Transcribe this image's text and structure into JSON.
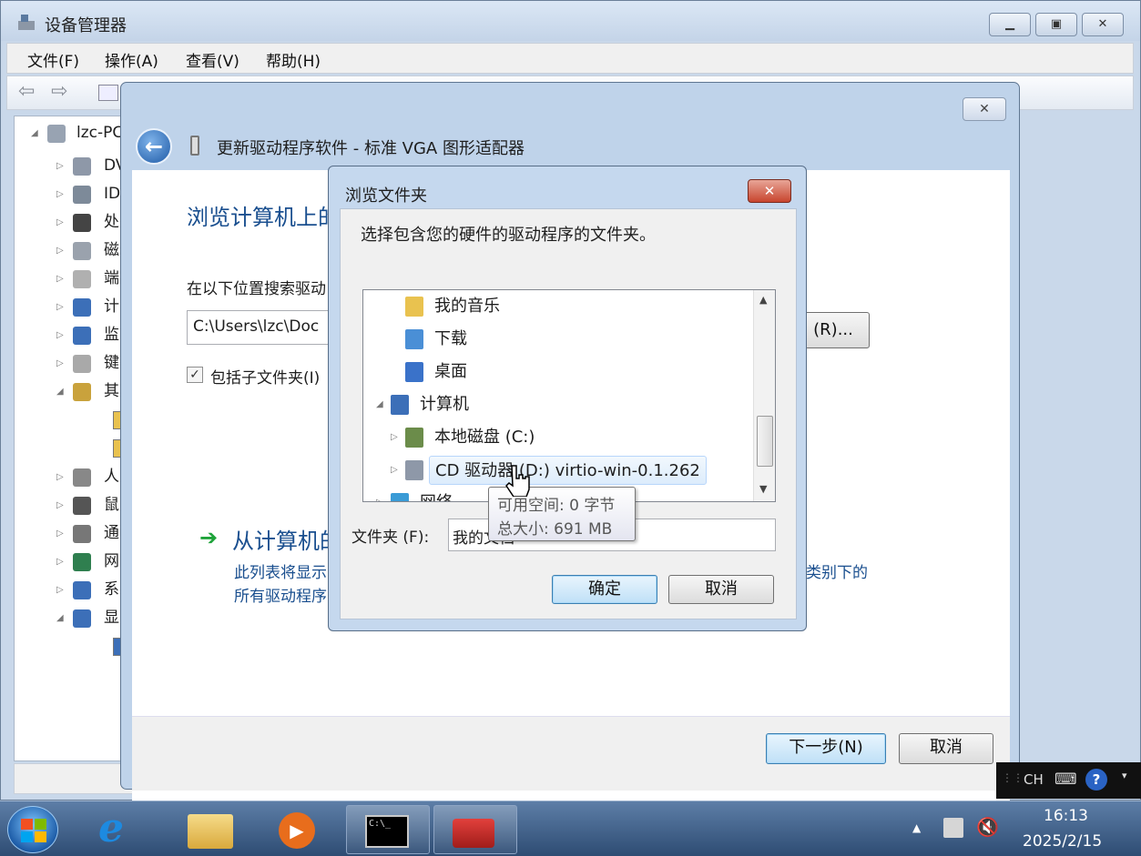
{
  "device_manager": {
    "title": "设备管理器",
    "menu": [
      "文件(F)",
      "操作(A)",
      "查看(V)",
      "帮助(H)"
    ],
    "caption_buttons": [
      "minimize-icon",
      "maximize-icon",
      "close-icon"
    ],
    "tree": {
      "root": "lzc-PC",
      "items": [
        {
          "label": "DV",
          "icon": "dvd-drive-icon"
        },
        {
          "label": "ID",
          "icon": "ide-controller-icon"
        },
        {
          "label": "处",
          "icon": "processor-icon"
        },
        {
          "label": "磁",
          "icon": "disk-drive-icon"
        },
        {
          "label": "端",
          "icon": "port-icon"
        },
        {
          "label": "计",
          "icon": "computer-icon"
        },
        {
          "label": "监",
          "icon": "monitor-icon"
        },
        {
          "label": "键",
          "icon": "keyboard-icon"
        },
        {
          "label": "其",
          "icon": "other-devices-icon"
        },
        {
          "label": "人",
          "icon": "hid-icon"
        },
        {
          "label": "鼠",
          "icon": "mouse-icon"
        },
        {
          "label": "通",
          "icon": "usb-icon"
        },
        {
          "label": "网",
          "icon": "network-adapter-icon"
        },
        {
          "label": "系",
          "icon": "system-device-icon"
        },
        {
          "label": "显",
          "icon": "display-adapter-icon"
        }
      ]
    }
  },
  "wizard": {
    "title": "更新驱动程序软件 - 标准 VGA 图形适配器",
    "heading": "浏览计算机上的",
    "search_label": "在以下位置搜索驱动",
    "path_value": "C:\\Users\\lzc\\Doc",
    "browse_button": "(R)...",
    "include_subfolders": "包括子文件夹(I)",
    "include_subfolders_checked": true,
    "pick_link": "从计算机的",
    "pick_desc_1": "此列表将显示",
    "pick_desc_1_tail": "类别下的",
    "pick_desc_2": "所有驱动程序",
    "next_button": "下一步(N)",
    "cancel_button": "取消"
  },
  "browse_dialog": {
    "title": "浏览文件夹",
    "instruction": "选择包含您的硬件的驱动程序的文件夹。",
    "items": [
      {
        "label": "我的音乐",
        "icon": "music-folder-icon"
      },
      {
        "label": "下载",
        "icon": "downloads-folder-icon"
      },
      {
        "label": "桌面",
        "icon": "desktop-folder-icon"
      },
      {
        "label": "计算机",
        "icon": "computer-icon"
      },
      {
        "label": "本地磁盘 (C:)",
        "icon": "local-disk-icon"
      },
      {
        "label": "CD 驱动器 (D:) virtio-win-0.1.262",
        "icon": "cd-drive-icon"
      },
      {
        "label": "网络",
        "icon": "network-icon"
      }
    ],
    "folder_label": "文件夹 (F):",
    "folder_value": "我的文档",
    "ok_button": "确定",
    "cancel_button": "取消"
  },
  "tooltip": {
    "free_space": "可用空间: 0 字节",
    "total_size": "总大小: 691 MB"
  },
  "language_bar": {
    "lang": "CH"
  },
  "taskbar": {
    "apps": [
      "start-orb-icon",
      "internet-explorer-icon",
      "explorer-icon",
      "media-player-icon",
      "cmd-icon",
      "toolbox-icon"
    ],
    "time": "16:13",
    "date": "2025/2/15"
  }
}
